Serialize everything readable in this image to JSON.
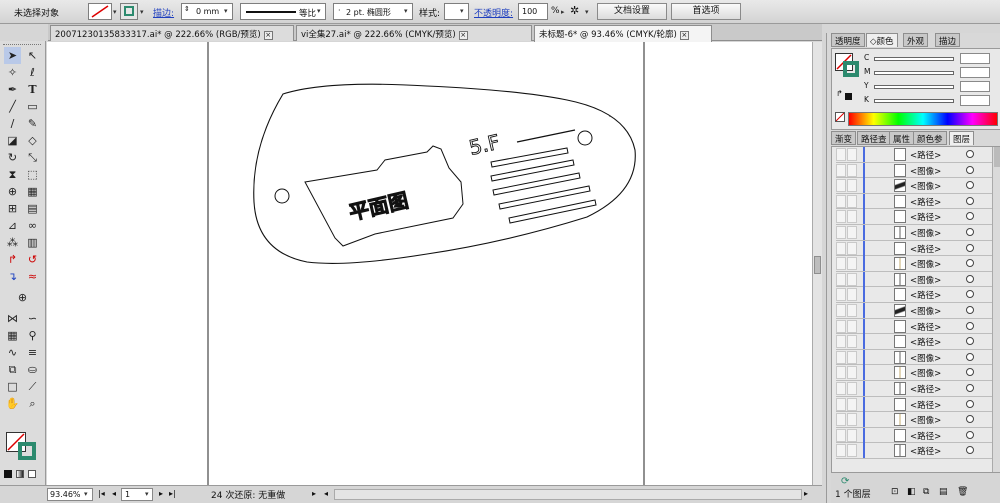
{
  "control_bar": {
    "selection_status": "未选择对象",
    "stroke_label": "描边:",
    "stroke_weight": "0 mm",
    "stroke_profile": "等比",
    "brush_def": "2 pt. 椭圆形",
    "style_label": "样式:",
    "opacity_label": "不透明度:",
    "opacity_value": "100",
    "opacity_unit": "%",
    "document_setup": "文档设置",
    "preferences": "首选项"
  },
  "tabs": [
    {
      "label": "20071230135833317.ai* @ 222.66% (RGB/预览)"
    },
    {
      "label": "vi全集27.ai* @ 222.66% (CMYK/预览)"
    },
    {
      "label": "未标题-6* @ 93.46% (CMYK/轮廓)"
    }
  ],
  "artwork": {
    "title_text": "平面图",
    "floor_text": "5.F"
  },
  "status_bar": {
    "zoom": "93.46%",
    "page": "1",
    "undo_info": "24 次还原: 无重做"
  },
  "color_panel": {
    "tabs": [
      "透明度",
      "颜色",
      "外观",
      "描边"
    ],
    "channels": [
      "C",
      "M",
      "Y",
      "K"
    ],
    "channel_values": [
      "",
      "",
      "",
      ""
    ]
  },
  "layers_panel": {
    "tabs": [
      "渐变",
      "路径查",
      "属性",
      "颜色参",
      "图层"
    ],
    "rows": [
      {
        "name": "<路径>",
        "thumb": "plain"
      },
      {
        "name": "<图像>",
        "thumb": "plain"
      },
      {
        "name": "<图像>",
        "thumb": "dark"
      },
      {
        "name": "<路径>",
        "thumb": "plain"
      },
      {
        "name": "<路径>",
        "thumb": "plain"
      },
      {
        "name": "<图像>",
        "thumb": "line"
      },
      {
        "name": "<路径>",
        "thumb": "plain"
      },
      {
        "name": "<图像>",
        "thumb": "light"
      },
      {
        "name": "<图像>",
        "thumb": "line"
      },
      {
        "name": "<路径>",
        "thumb": "plain"
      },
      {
        "name": "<图像>",
        "thumb": "dark"
      },
      {
        "name": "<路径>",
        "thumb": "plain"
      },
      {
        "name": "<路径>",
        "thumb": "plain"
      },
      {
        "name": "<图像>",
        "thumb": "line"
      },
      {
        "name": "<图像>",
        "thumb": "light"
      },
      {
        "name": "<路径>",
        "thumb": "line"
      },
      {
        "name": "<路径>",
        "thumb": "plain"
      },
      {
        "name": "<图像>",
        "thumb": "light"
      },
      {
        "name": "<路径>",
        "thumb": "plain"
      },
      {
        "name": "<路径>",
        "thumb": "line"
      }
    ],
    "footer_count": "1 个图层"
  },
  "colors": {
    "accent_blue": "#4a6be0",
    "stroke_green": "#2c8a6e"
  }
}
